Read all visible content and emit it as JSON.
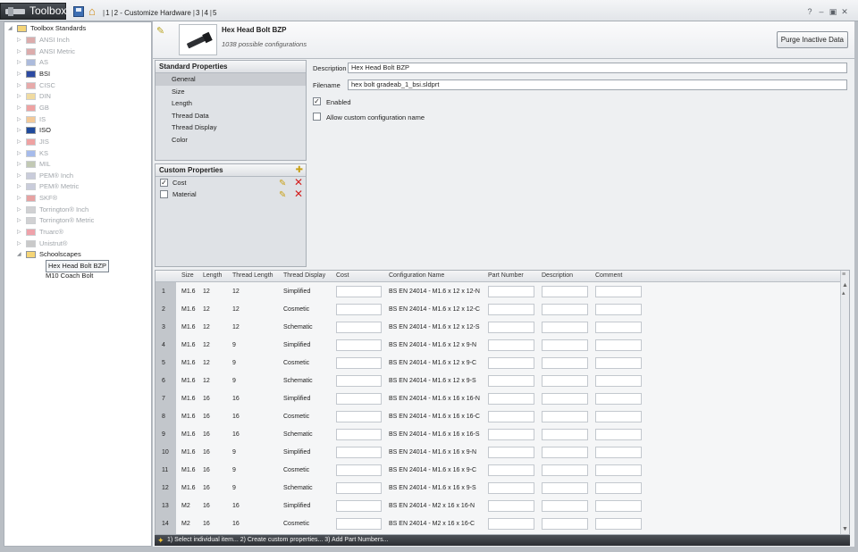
{
  "titlebar": {
    "app_title": "Toolbox",
    "steps": [
      "1",
      "2 - Customize Hardware",
      "3",
      "4",
      "5"
    ],
    "window_icons": [
      "help-icon",
      "minimize-icon",
      "restore-icon",
      "close-icon"
    ]
  },
  "tree": {
    "root": "Toolbox Standards",
    "items": [
      {
        "label": "ANSI Inch",
        "enabled": false
      },
      {
        "label": "ANSI Metric",
        "enabled": false
      },
      {
        "label": "AS",
        "enabled": false
      },
      {
        "label": "BSI",
        "enabled": true
      },
      {
        "label": "CISC",
        "enabled": false
      },
      {
        "label": "DIN",
        "enabled": false
      },
      {
        "label": "GB",
        "enabled": false
      },
      {
        "label": "IS",
        "enabled": false
      },
      {
        "label": "ISO",
        "enabled": true
      },
      {
        "label": "JIS",
        "enabled": false
      },
      {
        "label": "KS",
        "enabled": false
      },
      {
        "label": "MIL",
        "enabled": false
      },
      {
        "label": "PEM® Inch",
        "enabled": false
      },
      {
        "label": "PEM® Metric",
        "enabled": false
      },
      {
        "label": "SKF®",
        "enabled": false
      },
      {
        "label": "Torrington® Inch",
        "enabled": false
      },
      {
        "label": "Torrington® Metric",
        "enabled": false
      },
      {
        "label": "Truarc®",
        "enabled": false
      },
      {
        "label": "Unistrut®",
        "enabled": false
      }
    ],
    "folder": "Schoolscapes",
    "children": [
      "Hex Head Bolt BZP",
      "M10 Coach Bolt"
    ]
  },
  "header": {
    "title": "Hex Head Bolt BZP",
    "subtitle": "1038 possible configurations",
    "purge_button": "Purge Inactive Data"
  },
  "standard_properties": {
    "title": "Standard Properties",
    "items": [
      "General",
      "Size",
      "Length",
      "Thread Data",
      "Thread Display",
      "Color"
    ]
  },
  "custom_properties": {
    "title": "Custom Properties",
    "items": [
      {
        "label": "Cost",
        "checked": true
      },
      {
        "label": "Material",
        "checked": false
      }
    ]
  },
  "form": {
    "description_label": "Description",
    "description_value": "Hex Head Bolt BZP",
    "filename_label": "Filename",
    "filename_value": "hex bolt gradeab_1_bsi.sldprt",
    "enabled_label": "Enabled",
    "enabled_checked": true,
    "custom_name_label": "Allow custom configuration name",
    "custom_name_checked": false
  },
  "grid": {
    "columns": [
      "Size",
      "Length",
      "Thread Length",
      "Thread Display",
      "Cost",
      "Configuration Name",
      "Part Number",
      "Description",
      "Comment"
    ],
    "rows": [
      {
        "n": "1",
        "size": "M1.6",
        "length": "12",
        "thread_length": "12",
        "display": "Simplified",
        "config": "BS EN 24014 - M1.6 x 12 x 12-N"
      },
      {
        "n": "2",
        "size": "M1.6",
        "length": "12",
        "thread_length": "12",
        "display": "Cosmetic",
        "config": "BS EN 24014 - M1.6 x 12 x 12-C"
      },
      {
        "n": "3",
        "size": "M1.6",
        "length": "12",
        "thread_length": "12",
        "display": "Schematic",
        "config": "BS EN 24014 - M1.6 x 12 x 12-S"
      },
      {
        "n": "4",
        "size": "M1.6",
        "length": "12",
        "thread_length": "9",
        "display": "Simplified",
        "config": "BS EN 24014 - M1.6 x 12 x 9-N"
      },
      {
        "n": "5",
        "size": "M1.6",
        "length": "12",
        "thread_length": "9",
        "display": "Cosmetic",
        "config": "BS EN 24014 - M1.6 x 12 x 9-C"
      },
      {
        "n": "6",
        "size": "M1.6",
        "length": "12",
        "thread_length": "9",
        "display": "Schematic",
        "config": "BS EN 24014 - M1.6 x 12 x 9-S"
      },
      {
        "n": "7",
        "size": "M1.6",
        "length": "16",
        "thread_length": "16",
        "display": "Simplified",
        "config": "BS EN 24014 - M1.6 x 16 x 16-N"
      },
      {
        "n": "8",
        "size": "M1.6",
        "length": "16",
        "thread_length": "16",
        "display": "Cosmetic",
        "config": "BS EN 24014 - M1.6 x 16 x 16-C"
      },
      {
        "n": "9",
        "size": "M1.6",
        "length": "16",
        "thread_length": "16",
        "display": "Schematic",
        "config": "BS EN 24014 - M1.6 x 16 x 16-S"
      },
      {
        "n": "10",
        "size": "M1.6",
        "length": "16",
        "thread_length": "9",
        "display": "Simplified",
        "config": "BS EN 24014 - M1.6 x 16 x 9-N"
      },
      {
        "n": "11",
        "size": "M1.6",
        "length": "16",
        "thread_length": "9",
        "display": "Cosmetic",
        "config": "BS EN 24014 - M1.6 x 16 x 9-C"
      },
      {
        "n": "12",
        "size": "M1.6",
        "length": "16",
        "thread_length": "9",
        "display": "Schematic",
        "config": "BS EN 24014 - M1.6 x 16 x 9-S"
      },
      {
        "n": "13",
        "size": "M2",
        "length": "16",
        "thread_length": "16",
        "display": "Simplified",
        "config": "BS EN 24014 - M2 x 16 x 16-N"
      },
      {
        "n": "14",
        "size": "M2",
        "length": "16",
        "thread_length": "16",
        "display": "Cosmetic",
        "config": "BS EN 24014 - M2 x 16 x 16-C"
      }
    ]
  },
  "status": {
    "text": "1) Select individual item... 2) Create custom properties... 3) Add Part Numbers..."
  }
}
